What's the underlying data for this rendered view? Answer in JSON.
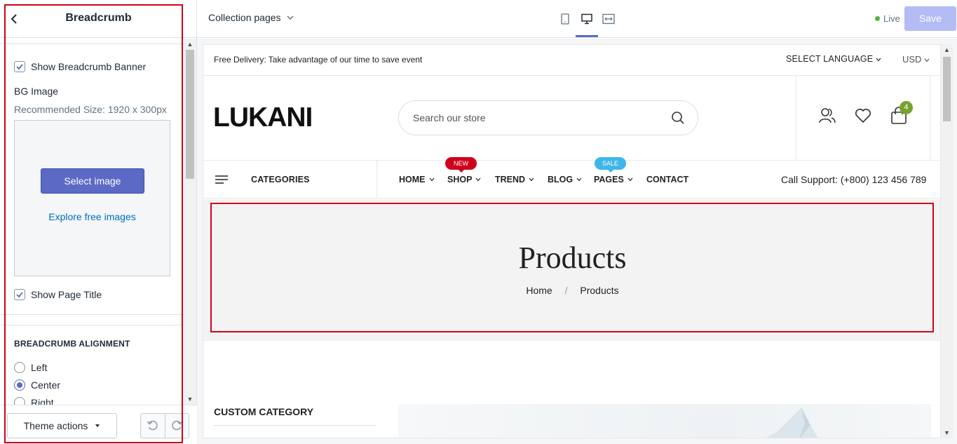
{
  "sidebar": {
    "title": "Breadcrumb",
    "show_banner_label": "Show Breadcrumb Banner",
    "show_banner_checked": true,
    "bg_image_label": "BG Image",
    "recommended_size": "Recommended Size: 1920 x 300px",
    "select_image_label": "Select image",
    "explore_label": "Explore free images",
    "show_title_label": "Show Page Title",
    "show_title_checked": true,
    "alignment_heading": "BREADCRUMB ALIGNMENT",
    "alignment_options": [
      {
        "label": "Left",
        "selected": false
      },
      {
        "label": "Center",
        "selected": true
      },
      {
        "label": "Right",
        "selected": false
      }
    ],
    "theme_actions_label": "Theme actions"
  },
  "topbar": {
    "page_select": "Collection pages",
    "live_label": "Live",
    "save_label": "Save",
    "active_device": "desktop"
  },
  "preview": {
    "promo_text": "Free Delivery: Take advantage of our time to save event",
    "language_label": "SELECT LANGUAGE",
    "currency_label": "USD",
    "logo_text": "LUKANI",
    "search_placeholder": "Search our store",
    "cart_count": "4",
    "categories_label": "CATEGORIES",
    "nav": [
      {
        "label": "HOME",
        "badge": ""
      },
      {
        "label": "SHOP",
        "badge": "NEW"
      },
      {
        "label": "TREND",
        "badge": ""
      },
      {
        "label": "BLOG",
        "badge": ""
      },
      {
        "label": "PAGES",
        "badge": "SALE"
      },
      {
        "label": "CONTACT",
        "badge": ""
      }
    ],
    "support_text": "Call Support: (+800) 123 456 789",
    "banner_title": "Products",
    "breadcrumb": {
      "home": "Home",
      "separator": "/",
      "current": "Products"
    },
    "custom_category_label": "CUSTOM CATEGORY"
  },
  "colors": {
    "accent": "#5c6ac4",
    "highlight_frame": "#d0021b",
    "new_badge": "#d0021b",
    "sale_badge": "#3fb6e8",
    "cart_badge": "#78a22f",
    "live_dot": "#50b83c"
  }
}
